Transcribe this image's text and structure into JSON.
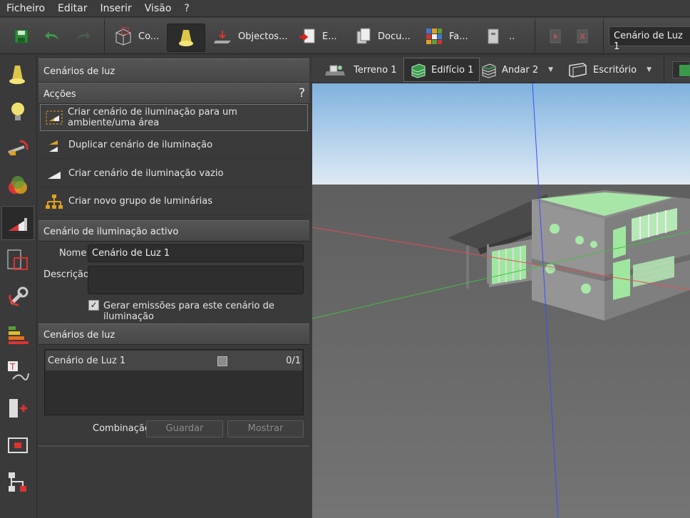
{
  "menu": [
    "Ficheiro",
    "Editar",
    "Inserir",
    "Visão",
    "?"
  ],
  "toolbar": {
    "construction_label": "Co...",
    "objects_label": "Objectos...",
    "export_label": "E...",
    "documentation_label": "Docu...",
    "facades_label": "Fa...",
    "more_label": "..",
    "scene_selector_value": "Cenário de Luz 1"
  },
  "viewbar": {
    "terrain": "Terreno 1",
    "building": "Edifício 1",
    "floor": "Andar 2",
    "room": "Escritório"
  },
  "panel": {
    "title": "Cenários de luz",
    "actions_header": "Acções",
    "help": "?",
    "actions": [
      "Criar cenário de iluminação para um ambiente/uma área",
      "Duplicar cenário de iluminação",
      "Criar cenário de iluminação vazio",
      "Criar novo grupo de luminárias"
    ],
    "active_header": "Cenário de iluminação activo",
    "name_label": "Nome",
    "name_value": "Cenário de Luz 1",
    "description_label": "Descrição",
    "description_value": "",
    "emissions_label": "Gerar emissões para este cenário de iluminação",
    "emissions_checked": true,
    "scenes_header": "Cenários de luz",
    "scenes": [
      {
        "name": "Cenário de Luz 1",
        "count": "0/1"
      }
    ],
    "combination_label": "Combinação",
    "save_label": "Guardar",
    "show_label": "Mostrar"
  },
  "colors": {
    "accent": "#e0a020",
    "panel": "#3a3a3a",
    "sky": "#aecde8",
    "ground": "#6e6e6e",
    "glass": "#9fe79f"
  }
}
